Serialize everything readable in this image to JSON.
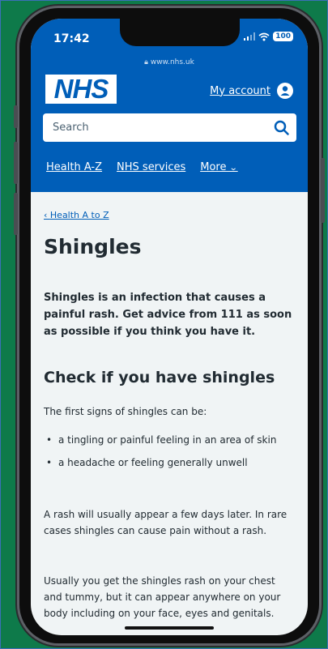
{
  "status": {
    "time": "17:42",
    "battery": "100"
  },
  "browser": {
    "url": "www.nhs.uk"
  },
  "header": {
    "logo": "NHS",
    "account_label": "My account",
    "search_placeholder": "Search",
    "nav": [
      "Health A-Z",
      "NHS services",
      "More"
    ]
  },
  "article": {
    "breadcrumb": "Health A to Z",
    "title": "Shingles",
    "lead": "Shingles is an infection that causes a painful rash. Get advice from 111 as soon as possible if you think you have it.",
    "section_heading": "Check if you have shingles",
    "intro": "The first signs of shingles can be:",
    "bullets": [
      "a tingling or painful feeling in an area of skin",
      "a headache or feeling generally unwell"
    ],
    "para2": "A rash will usually appear a few days later. In rare cases shingles can cause pain without a rash.",
    "para3": "Usually you get the shingles rash on your chest and tummy, but it can appear anywhere on your body including on your face, eyes and genitals."
  },
  "colors": {
    "nhs_blue": "#005eb8",
    "background": "#f0f4f5",
    "text": "#212b32"
  }
}
